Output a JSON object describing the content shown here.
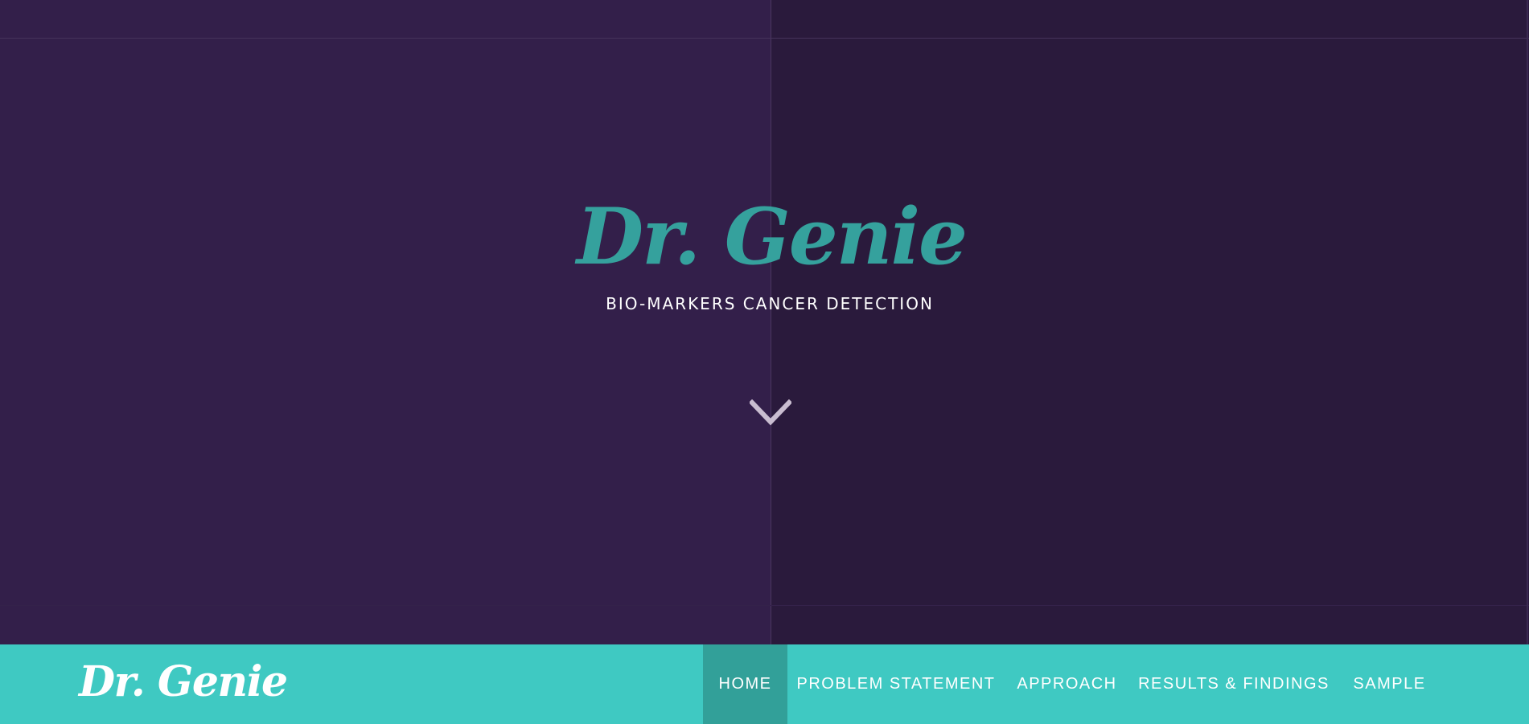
{
  "hero": {
    "title": "Dr. Genie",
    "subtitle": "BIO-MARKERS CANCER DETECTION",
    "scroll_icon": "chevron-down-icon"
  },
  "navbar": {
    "brand": "Dr. Genie",
    "items": [
      {
        "label": "HOME",
        "active": true
      },
      {
        "label": "PROBLEM STATEMENT",
        "active": false
      },
      {
        "label": "APPROACH",
        "active": false
      },
      {
        "label": "RESULTS & FINDINGS",
        "active": false
      },
      {
        "label": "SAMPLE",
        "active": false
      }
    ]
  },
  "colors": {
    "hero_left_bg": "#331f4a",
    "hero_right_bg": "#2a1a3c",
    "title": "#35a19d",
    "navbar_bg": "#3fc9c2",
    "nav_active_bg": "#32a099",
    "chevron": "#c9bdd0"
  }
}
